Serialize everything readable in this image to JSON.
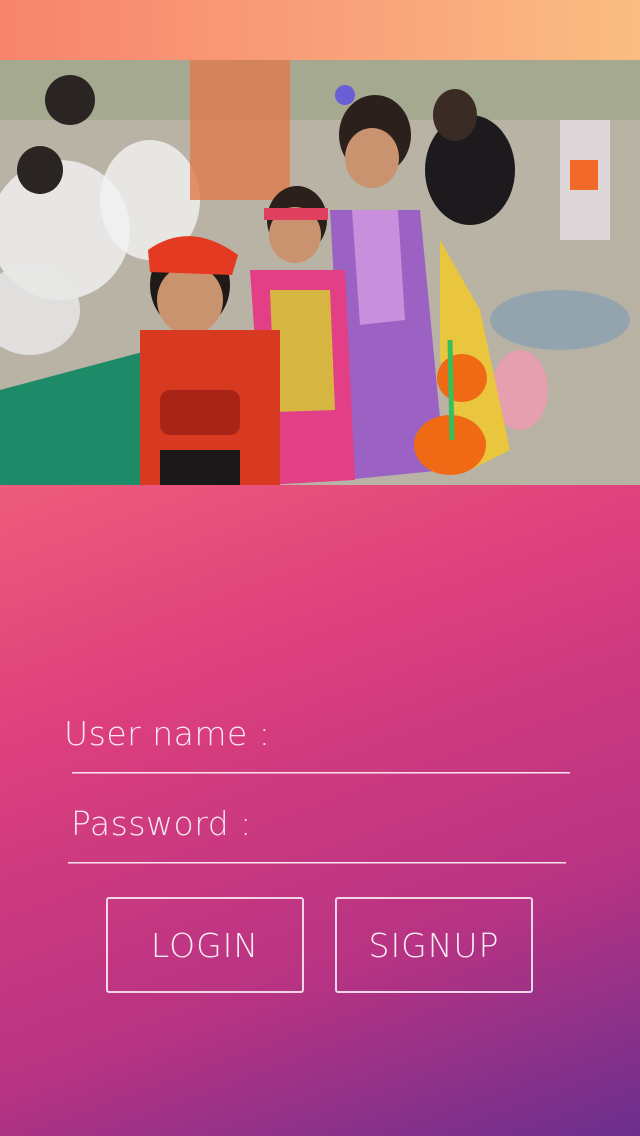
{
  "colors": {
    "gradient_top": "#fa8a5e",
    "gradient_mid": "#dd3f7d",
    "gradient_bottom": "#6b2f8e",
    "text": "#ffffff"
  },
  "hero": {
    "image_subject": "children in Halloween costumes"
  },
  "login_form": {
    "username_label": "User name :",
    "username_value": "",
    "password_label": "Password :",
    "password_value": "",
    "login_button_label": "LOGIN",
    "signup_button_label": "SIGNUP"
  }
}
